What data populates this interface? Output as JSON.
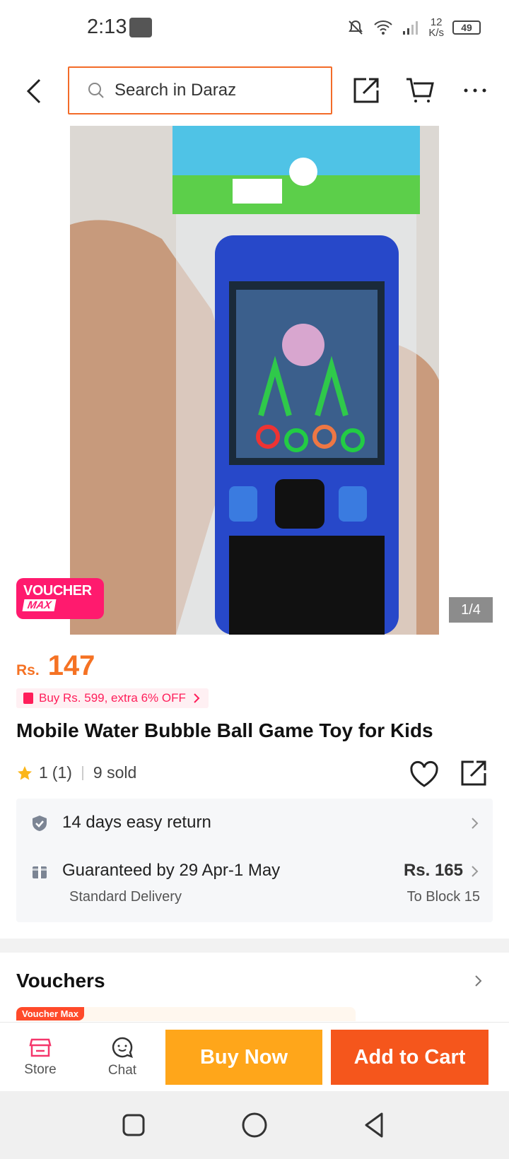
{
  "status_bar": {
    "time": "2:13",
    "net_speed_value": "12",
    "net_speed_unit": "K/s",
    "battery": "49"
  },
  "header": {
    "search_placeholder": "Search in Daraz"
  },
  "gallery": {
    "counter": "1/4",
    "voucher_line1": "VOUCHER",
    "voucher_line2": "MAX"
  },
  "price": {
    "currency": "Rs.",
    "value": "147"
  },
  "promo": {
    "text": "Buy Rs. 599, extra 6% OFF"
  },
  "product": {
    "title": "Mobile Water Bubble Ball Game Toy for Kids",
    "rating": "1",
    "rating_count": "(1)",
    "sold": "9 sold"
  },
  "delivery": {
    "return_text": "14 days easy return",
    "guarantee_text": "Guaranteed by 29 Apr-1 May",
    "delivery_type": "Standard Delivery",
    "fee": "Rs. 165",
    "destination": "To Block 15"
  },
  "vouchers": {
    "title": "Vouchers",
    "card_label": "Voucher Max"
  },
  "action_bar": {
    "store_label": "Store",
    "chat_label": "Chat",
    "buy_now": "Buy Now",
    "add_to_cart": "Add to Cart"
  },
  "colors": {
    "accent": "#f57224",
    "buy_now": "#ffa61a",
    "add_to_cart": "#f5561c",
    "voucher_pink": "#ff1a6e"
  }
}
